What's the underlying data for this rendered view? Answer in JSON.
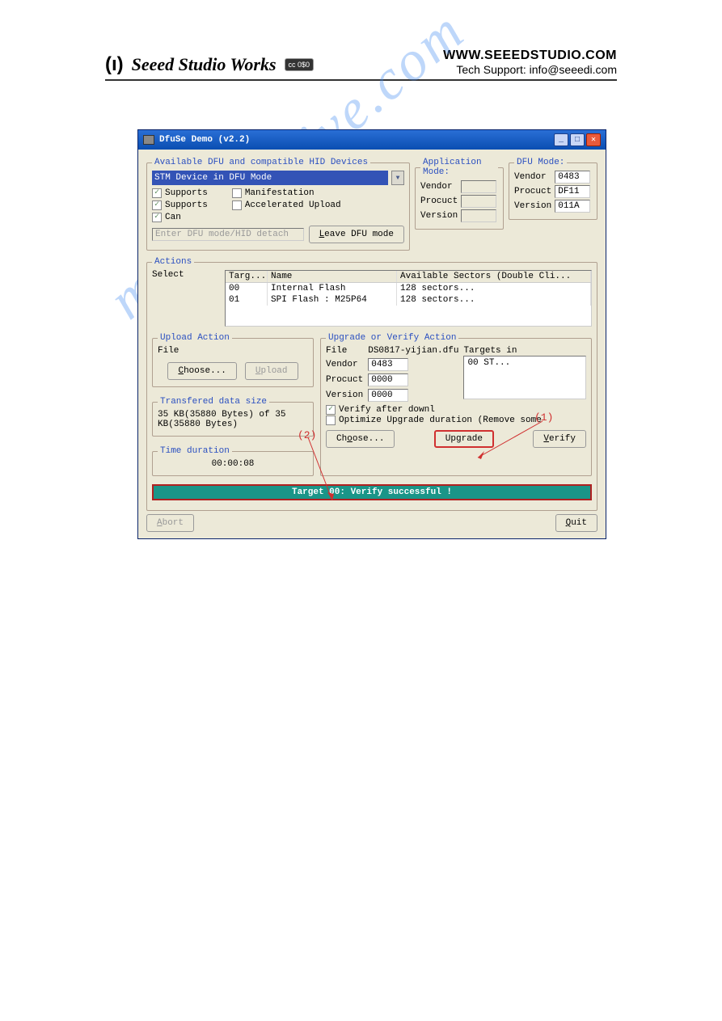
{
  "page_header": {
    "brand_text": "Seeed Studio Works",
    "cc_badge": "cc 0$0",
    "url": "WWW.SEEEDSTUDIO.COM",
    "support": "Tech Support: info@seeedi.com"
  },
  "watermark": "manualshive.com",
  "window": {
    "title": "DfuSe Demo (v2.2)",
    "devices_box": {
      "legend": "Available DFU and compatible HID Devices",
      "selected": "STM Device in DFU Mode",
      "supports1": "Supports",
      "supports2": "Supports",
      "can": "Can",
      "manifestation": "Manifestation",
      "accelerated": "Accelerated Upload",
      "enter_placeholder": "Enter DFU mode/HID detach",
      "leave_btn": "Leave DFU mode"
    },
    "app_mode": {
      "legend": "Application Mode:",
      "vendor_label": "Vendor",
      "procuct_label": "Procuct",
      "version_label": "Version",
      "vendor": "",
      "procuct": "",
      "version": ""
    },
    "dfu_mode": {
      "legend": "DFU Mode:",
      "vendor_label": "Vendor",
      "procuct_label": "Procuct",
      "version_label": "Version",
      "vendor": "0483",
      "procuct": "DF11",
      "version": "011A"
    },
    "actions": {
      "legend": "Actions",
      "select_label": "Select",
      "columns": {
        "targ": "Targ...",
        "name": "Name",
        "sectors": "Available Sectors (Double Cli..."
      },
      "rows": [
        {
          "targ": "00",
          "name": "Internal Flash",
          "sectors": "128 sectors..."
        },
        {
          "targ": "01",
          "name": "SPI Flash : M25P64",
          "sectors": "128 sectors..."
        }
      ]
    },
    "upload": {
      "legend": "Upload Action",
      "file_label": "File",
      "choose": "Choose...",
      "upload": "Upload"
    },
    "transfer": {
      "legend": "Transfered data size",
      "text": "35 KB(35880 Bytes) of 35 KB(35880 Bytes)"
    },
    "time": {
      "legend": "Time duration",
      "value": "00:00:08"
    },
    "upgrade": {
      "legend": "Upgrade or Verify Action",
      "file_label": "File",
      "file_value": "DS0817-yijian.dfu",
      "vendor_label": "Vendor",
      "vendor": "0483",
      "procuct_label": "Procuct",
      "procuct": "0000",
      "version_label": "Version",
      "version": "0000",
      "targets_in": "Targets in",
      "target_row": "00    ST...",
      "verify_after": "Verify after downl",
      "optimize": "Optimize Upgrade duration (Remove some",
      "choose": "Choose...",
      "upgrade_btn": "Upgrade",
      "verify_btn": "Verify"
    },
    "status": "Target 00: Verify successful !",
    "abort": "Abort",
    "quit": "Quit"
  },
  "annotations": {
    "a1": "(1)",
    "a2": "(2)"
  }
}
